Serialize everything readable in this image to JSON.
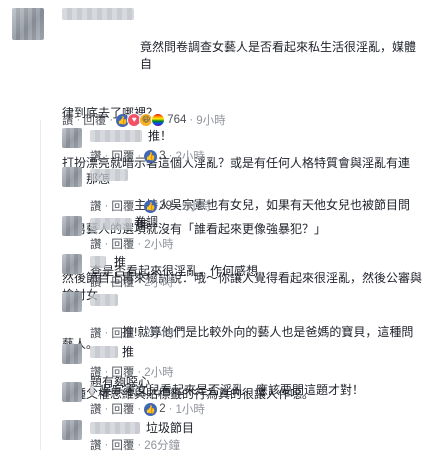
{
  "comment_main": {
    "line1": "竟然問卷調查女藝人是否看起來私生活很淫亂，媒體自",
    "line2": "律到底去了哪裡？",
    "line3": "打扮漂亮就暗示著這個人淫亂？或是有任何人格特質會與淫亂有連結？那怎",
    "line4": "麼男藝人的選項就沒有「誰看起來更像強暴犯？」",
    "line5": "然後節目上再來檢討說：哦～你讓人覺得看起來很淫亂，然後公審與檢討女",
    "line6": "藝人。",
    "line7": "這種父權思維與貼標籤的行為真的很讓人作噁。",
    "like": "讚",
    "reply": "回覆",
    "count": "764",
    "time": "9小時"
  },
  "replies": [
    {
      "text": "推！",
      "count": "3",
      "time": "2小時"
    },
    {
      "text_line1": "主持人吳宗憲也有女兒，如果有天他女兒也被節目問卷調",
      "text_line2": "查是否看起來很淫亂，作何感想",
      "count": "39",
      "time": "2小時"
    },
    {
      "text": "推",
      "time": "2小時"
    },
    {
      "text": "推",
      "time": "2小時"
    },
    {
      "text_line1": "推!就算他們是比較外向的藝人也是爸媽的寶貝，這種問",
      "text_line2": "題有夠噁心",
      "time": "2小時"
    },
    {
      "text": "推",
      "time": "2小時"
    },
    {
      "text": "吳宗憲女兒看起來是否淫亂，應該要問這題才對！",
      "count": "2",
      "time": "1小時"
    },
    {
      "text": "垃圾節目",
      "time": "26分鐘"
    }
  ],
  "labels": {
    "like": "讚",
    "reply": "回覆",
    "dot": "·"
  },
  "colors": {
    "text": "#1d2129",
    "meta": "#90949c",
    "like_blue": "#4267b2"
  },
  "icons": [
    "like-icon",
    "love-icon",
    "haha-icon",
    "rainbow-icon"
  ]
}
